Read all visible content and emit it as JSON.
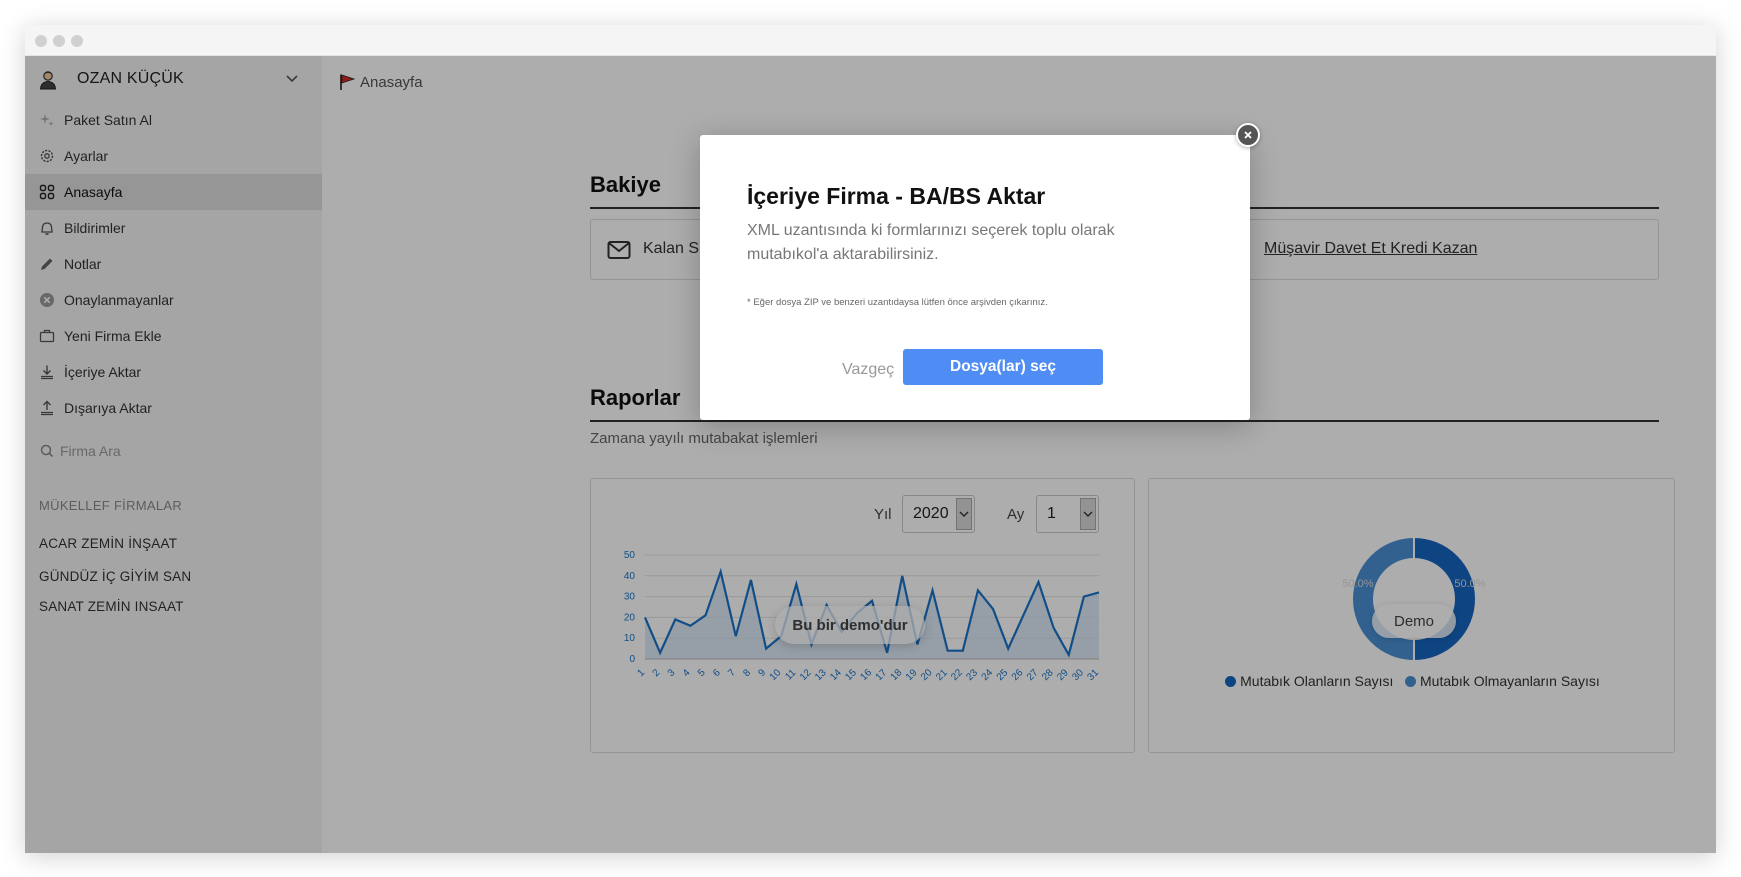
{
  "user": {
    "name": "OZAN KÜÇÜK"
  },
  "sidebar": {
    "items": [
      {
        "label": "Paket Satın Al",
        "icon": "sparkle-icon"
      },
      {
        "label": "Ayarlar",
        "icon": "gear-icon"
      },
      {
        "label": "Anasayfa",
        "icon": "grid-icon",
        "active": true
      },
      {
        "label": "Bildirimler",
        "icon": "bell-icon"
      },
      {
        "label": "Notlar",
        "icon": "pencil-icon"
      },
      {
        "label": "Onaylanmayanlar",
        "icon": "x-circle-icon"
      },
      {
        "label": "Yeni Firma Ekle",
        "icon": "briefcase-icon"
      },
      {
        "label": "İçeriye Aktar",
        "icon": "download-icon"
      },
      {
        "label": "Dışarıya Aktar",
        "icon": "upload-icon"
      }
    ],
    "search_placeholder": "Firma Ara",
    "section_title": "MÜKELLEF FİRMALAR",
    "firms": [
      "ACAR ZEMİN İNŞAAT",
      "GÜNDÜZ İÇ GİYİM SAN",
      "SANAT ZEMİN INSAAT"
    ]
  },
  "main": {
    "breadcrumb": "Anasayfa",
    "balance": {
      "title": "Bakiye",
      "sms_label": "Kalan S",
      "invite_link": "Müşavir Davet Et Kredi Kazan"
    },
    "reports": {
      "title": "Raporlar",
      "subtitle": "Zamana yayılı mutabakat işlemleri",
      "year_label": "Yıl",
      "year_value": "2020",
      "month_label": "Ay",
      "month_value": "1",
      "demo_badge": "Bu bir demo'dur",
      "donut_badge": "Demo"
    }
  },
  "modal": {
    "title": "İçeriye Firma - BA/BS Aktar",
    "description": "XML uzantısında ki formlarınızı seçerek toplu olarak mutabıkol'a aktarabilirsiniz.",
    "note": "* Eğer dosya ZIP ve benzeri uzantıdaysa lütfen önce arşivden çıkarınız.",
    "cancel_label": "Vazgeç",
    "primary_label": "Dosya(lar) seç"
  },
  "colors": {
    "primary": "#4f8df5",
    "chart_blue": "#1a73c9",
    "chart_fill": "#cfe0f2"
  },
  "chart_data": [
    {
      "type": "area",
      "categories": [
        "1",
        "2",
        "3",
        "4",
        "5",
        "6",
        "7",
        "8",
        "9",
        "10",
        "11",
        "12",
        "13",
        "14",
        "15",
        "16",
        "17",
        "18",
        "19",
        "20",
        "21",
        "22",
        "23",
        "24",
        "25",
        "26",
        "27",
        "28",
        "29",
        "30",
        "31"
      ],
      "values": [
        20,
        3,
        19,
        16,
        21,
        42,
        11,
        38,
        5,
        11,
        36,
        7,
        26,
        13,
        22,
        28,
        3,
        40,
        7,
        33,
        4,
        4,
        33,
        24,
        5,
        21,
        37,
        15,
        2,
        30,
        32
      ],
      "ylim": [
        0,
        50
      ],
      "yticks": [
        0,
        10,
        20,
        30,
        40,
        50
      ],
      "grid": true
    },
    {
      "type": "pie",
      "variant": "donut",
      "slices": [
        {
          "name": "Mutabık Olanların Sayısı",
          "value": 50.0,
          "label": "50.0%",
          "color": "#1565c0"
        },
        {
          "name": "Mutabık Olmayanların Sayısı",
          "value": 50.0,
          "label": "50.0%",
          "color": "#4a8fd4"
        }
      ],
      "legend": "bottom"
    }
  ]
}
